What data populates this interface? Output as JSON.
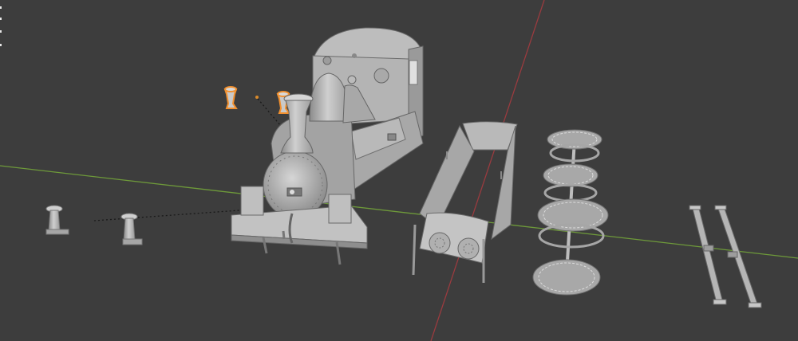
{
  "viewport": {
    "background": "#3d3d3d",
    "axis_x_color": "#9a3b3f",
    "axis_y_color": "#6e9a3a",
    "selection_color": "#f2902e",
    "grid_dot_color": "#d98a2b"
  },
  "objects": [
    {
      "name": "locomotive-body",
      "kind": "mesh",
      "selected": false
    },
    {
      "name": "chimney",
      "kind": "mesh",
      "selected": false
    },
    {
      "name": "steam-dome",
      "kind": "mesh",
      "selected": false
    },
    {
      "name": "loco-frame",
      "kind": "mesh",
      "selected": false
    },
    {
      "name": "wheelsets",
      "kind": "mesh",
      "selected": false
    },
    {
      "name": "coupling-rods",
      "kind": "mesh",
      "selected": false
    },
    {
      "name": "buffer-left",
      "kind": "mesh",
      "selected": false
    },
    {
      "name": "buffer-right",
      "kind": "mesh",
      "selected": false
    },
    {
      "name": "selected-buffer-a",
      "kind": "mesh",
      "selected": true
    },
    {
      "name": "selected-buffer-b",
      "kind": "mesh",
      "selected": true
    }
  ]
}
